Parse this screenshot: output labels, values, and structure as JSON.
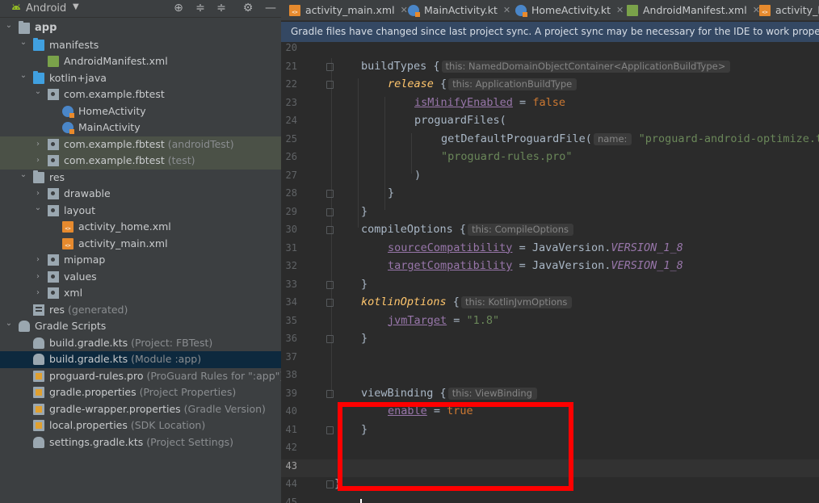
{
  "project_panel": {
    "view_selector": "Android",
    "tree": [
      {
        "label": "app",
        "bold": true,
        "depth": 0,
        "arrow": "down",
        "icon": "module-folder"
      },
      {
        "label": "manifests",
        "depth": 1,
        "arrow": "down",
        "icon": "folder-blue"
      },
      {
        "label": "AndroidManifest.xml",
        "depth": 2,
        "arrow": "",
        "icon": "manifest-file"
      },
      {
        "label": "kotlin+java",
        "depth": 1,
        "arrow": "down",
        "icon": "folder-blue"
      },
      {
        "label": "com.example.fbtest",
        "depth": 2,
        "arrow": "down",
        "icon": "package"
      },
      {
        "label": "HomeActivity",
        "depth": 3,
        "arrow": "",
        "icon": "kotlin-class"
      },
      {
        "label": "MainActivity",
        "depth": 3,
        "arrow": "",
        "icon": "kotlin-class"
      },
      {
        "label": "com.example.fbtest",
        "hint": " (androidTest)",
        "depth": 2,
        "arrow": "right",
        "icon": "package",
        "highlight": true
      },
      {
        "label": "com.example.fbtest",
        "hint": " (test)",
        "depth": 2,
        "arrow": "right",
        "icon": "package",
        "highlight": true
      },
      {
        "label": "res",
        "depth": 1,
        "arrow": "down",
        "icon": "res-folder"
      },
      {
        "label": "drawable",
        "depth": 2,
        "arrow": "right",
        "icon": "package"
      },
      {
        "label": "layout",
        "depth": 2,
        "arrow": "down",
        "icon": "package"
      },
      {
        "label": "activity_home.xml",
        "depth": 3,
        "arrow": "",
        "icon": "xml-file"
      },
      {
        "label": "activity_main.xml",
        "depth": 3,
        "arrow": "",
        "icon": "xml-file"
      },
      {
        "label": "mipmap",
        "depth": 2,
        "arrow": "right",
        "icon": "package"
      },
      {
        "label": "values",
        "depth": 2,
        "arrow": "right",
        "icon": "package"
      },
      {
        "label": "xml",
        "depth": 2,
        "arrow": "right",
        "icon": "package"
      },
      {
        "label": "res",
        "hint": " (generated)",
        "depth": 1,
        "arrow": "",
        "icon": "res-generated"
      },
      {
        "label": "Gradle Scripts",
        "depth": 0,
        "arrow": "down",
        "icon": "gradle"
      },
      {
        "label": "build.gradle.kts",
        "hint": " (Project: FBTest)",
        "depth": 1,
        "arrow": "",
        "icon": "gradle-file"
      },
      {
        "label": "build.gradle.kts",
        "hint": " (Module :app)",
        "depth": 1,
        "arrow": "",
        "icon": "gradle-file",
        "selected": true
      },
      {
        "label": "proguard-rules.pro",
        "hint": " (ProGuard Rules for \":app\")",
        "depth": 1,
        "arrow": "",
        "icon": "text-file"
      },
      {
        "label": "gradle.properties",
        "hint": " (Project Properties)",
        "depth": 1,
        "arrow": "",
        "icon": "properties-file"
      },
      {
        "label": "gradle-wrapper.properties",
        "hint": " (Gradle Version)",
        "depth": 1,
        "arrow": "",
        "icon": "properties-file"
      },
      {
        "label": "local.properties",
        "hint": " (SDK Location)",
        "depth": 1,
        "arrow": "",
        "icon": "properties-file"
      },
      {
        "label": "settings.gradle.kts",
        "hint": " (Project Settings)",
        "depth": 1,
        "arrow": "",
        "icon": "gradle-file"
      }
    ]
  },
  "tabs": [
    {
      "label": "activity_main.xml",
      "icon": "xml-file",
      "closable": true
    },
    {
      "label": "MainActivity.kt",
      "icon": "kotlin-class",
      "closable": true
    },
    {
      "label": "HomeActivity.kt",
      "icon": "kotlin-class",
      "closable": true
    },
    {
      "label": "AndroidManifest.xml",
      "icon": "manifest-file",
      "closable": true
    },
    {
      "label": "activity_h",
      "icon": "xml-file",
      "closable": false
    }
  ],
  "banner": "Gradle files have changed since last project sync. A project sync may be necessary for the IDE to work properly.",
  "editor": {
    "current_line": 43,
    "lines": [
      {
        "n": 20,
        "tokens": []
      },
      {
        "n": 21,
        "tokens": [
          [
            "fn",
            "buildTypes "
          ],
          [
            "plain",
            "{"
          ],
          [
            "inlay",
            "this: NamedDomainObjectContainer<ApplicationBuildType>"
          ]
        ]
      },
      {
        "n": 22,
        "tokens": [
          [
            "ital",
            "release "
          ],
          [
            "plain",
            "{"
          ],
          [
            "inlay",
            "this: ApplicationBuildType"
          ]
        ]
      },
      {
        "n": 23,
        "tokens": [
          [
            "prop",
            "isMinifyEnabled"
          ],
          [
            "plain",
            " = "
          ],
          [
            "kw",
            "false"
          ]
        ]
      },
      {
        "n": 24,
        "tokens": [
          [
            "fn",
            "proguardFiles("
          ]
        ]
      },
      {
        "n": 25,
        "tokens": [
          [
            "fn",
            "getDefaultProguardFile("
          ],
          [
            "inlay",
            "name:"
          ],
          [
            "str",
            " \"proguard-android-optimize.txt\""
          ]
        ]
      },
      {
        "n": 26,
        "tokens": [
          [
            "str",
            "\"proguard-rules.pro\""
          ]
        ]
      },
      {
        "n": 27,
        "tokens": [
          [
            "plain",
            ")"
          ]
        ]
      },
      {
        "n": 28,
        "tokens": [
          [
            "plain",
            "}"
          ]
        ]
      },
      {
        "n": 29,
        "tokens": [
          [
            "plain",
            "}"
          ]
        ]
      },
      {
        "n": 30,
        "tokens": [
          [
            "fn",
            "compileOptions "
          ],
          [
            "plain",
            "{"
          ],
          [
            "inlay",
            "this: CompileOptions"
          ]
        ]
      },
      {
        "n": 31,
        "tokens": [
          [
            "prop",
            "sourceCompatibility"
          ],
          [
            "plain",
            " = JavaVersion."
          ],
          [
            "const",
            "VERSION_1_8"
          ]
        ]
      },
      {
        "n": 32,
        "tokens": [
          [
            "prop",
            "targetCompatibility"
          ],
          [
            "plain",
            " = JavaVersion."
          ],
          [
            "const",
            "VERSION_1_8"
          ]
        ]
      },
      {
        "n": 33,
        "tokens": [
          [
            "plain",
            "}"
          ]
        ]
      },
      {
        "n": 34,
        "tokens": [
          [
            "ital",
            "kotlinOptions "
          ],
          [
            "plain",
            "{"
          ],
          [
            "inlay",
            "this: KotlinJvmOptions"
          ]
        ]
      },
      {
        "n": 35,
        "tokens": [
          [
            "prop",
            "jvmTarget"
          ],
          [
            "plain",
            " = "
          ],
          [
            "str",
            "\"1.8\""
          ]
        ]
      },
      {
        "n": 36,
        "tokens": [
          [
            "plain",
            "}"
          ]
        ]
      },
      {
        "n": 37,
        "tokens": []
      },
      {
        "n": 38,
        "tokens": []
      },
      {
        "n": 39,
        "tokens": [
          [
            "fn",
            "viewBinding "
          ],
          [
            "plain",
            "{"
          ],
          [
            "inlay",
            "this: ViewBinding"
          ]
        ]
      },
      {
        "n": 40,
        "tokens": [
          [
            "prop",
            "enable"
          ],
          [
            "plain",
            " = "
          ],
          [
            "kw",
            "true"
          ]
        ]
      },
      {
        "n": 41,
        "tokens": [
          [
            "plain",
            "}"
          ]
        ]
      },
      {
        "n": 42,
        "tokens": []
      },
      {
        "n": 43,
        "tokens": []
      },
      {
        "n": 44,
        "tokens": [
          [
            "plain",
            "}"
          ]
        ]
      },
      {
        "n": 45,
        "tokens": []
      }
    ]
  },
  "colors": {
    "panel_bg": "#3c3f41",
    "editor_bg": "#2b2b2b",
    "selection": "#0d293e",
    "banner_bg": "#344863",
    "annotation_box": "#ff0000"
  }
}
